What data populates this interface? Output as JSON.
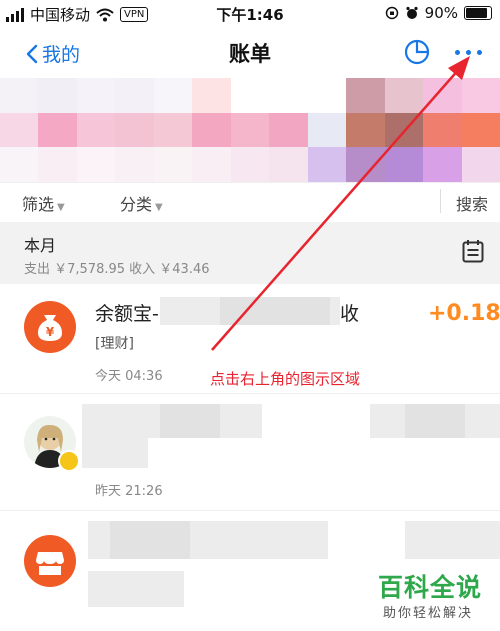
{
  "status_bar": {
    "carrier": "中国移动",
    "vpn": "VPN",
    "time": "下午1:46",
    "battery": "90%"
  },
  "nav": {
    "back_label": "我的",
    "title": "账单"
  },
  "filters": {
    "filter_label": "筛选",
    "category_label": "分类",
    "search_label": "搜索"
  },
  "month": {
    "title": "本月",
    "summary": "支出 ￥7,578.95   收入 ￥43.46"
  },
  "transactions": [
    {
      "title": "余额宝-",
      "title_suffix": "收",
      "tag": "[理财]",
      "amount": "+0.18",
      "time": "今天  04:36",
      "icon": "money-bag-icon"
    },
    {
      "time": "昨天  21:26",
      "icon": "avatar"
    },
    {
      "icon": "shop-icon"
    }
  ],
  "annotation": {
    "text": "点击右上角的图示区域"
  },
  "watermark": {
    "main": "百科全说",
    "sub": "助你轻松解决"
  },
  "colors": {
    "accent": "#1677e5",
    "amount": "#ff8a1f",
    "annotation": "#e8242f",
    "icon_orange": "#f05a24",
    "watermark": "#2ea84a"
  },
  "mosaic_colors": [
    "#f4f1f7",
    "#f1eef6",
    "#f5f3f9",
    "#f3f0f7",
    "#f7f4fa",
    "#fde3e3",
    "#ffffff",
    "#ffffff",
    "#ffffff",
    "#cd9ca7",
    "#e7c3cd",
    "#f5bfe0",
    "#f9c9e3",
    "#f7d7e6",
    "#f4a8c4",
    "#f6c5d7",
    "#f3c2d3",
    "#f5c8d6",
    "#f4a7c1",
    "#f5b5ca",
    "#f3a6c1",
    "#e7eaf4",
    "#c47b6a",
    "#ad6f6a",
    "#f07e6e",
    "#f57e60",
    "#f9f4f8",
    "#f8eef4",
    "#fbf3f7",
    "#f8f0f4",
    "#faf3f6",
    "#f9eef3",
    "#f6e7f0",
    "#f5e3ee",
    "#d6c1ee",
    "#b68dc9",
    "#b58bd8",
    "#d8a1e7",
    "#f2d6ec"
  ]
}
